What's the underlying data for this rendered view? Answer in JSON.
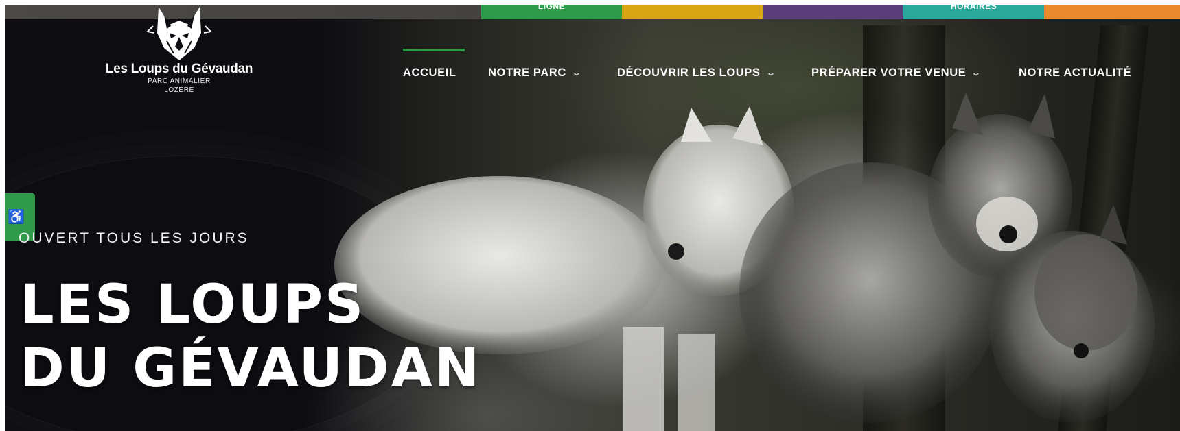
{
  "quick_links": [
    {
      "label": "LIGNE",
      "color": "#2f9a4a"
    },
    {
      "label": "",
      "color": "#d7a514"
    },
    {
      "label": "",
      "color": "#5a3d79"
    },
    {
      "label": "HORAIRES",
      "color": "#2aa99a"
    },
    {
      "label": "",
      "color": "#e98a2f"
    }
  ],
  "logo": {
    "name": "Les Loups du Gévaudan",
    "subtitle_line1": "PARC ANIMALIER",
    "subtitle_line2": "LOZÈRE",
    "icon": "wolf-head-icon"
  },
  "nav": {
    "items": [
      {
        "label": "ACCUEIL",
        "has_dropdown": false,
        "active": true
      },
      {
        "label": "NOTRE PARC",
        "has_dropdown": true,
        "active": false
      },
      {
        "label": "DÉCOUVRIR LES LOUPS",
        "has_dropdown": true,
        "active": false
      },
      {
        "label": "PRÉPARER VOTRE VENUE",
        "has_dropdown": true,
        "active": false
      },
      {
        "label": "NOTRE ACTUALITÉ",
        "has_dropdown": false,
        "active": false
      }
    ],
    "dropdown_icon": "chevron-down-icon",
    "active_color": "#2f9a4a"
  },
  "side_tab": {
    "icon": "accessibility-icon",
    "color": "#2f9a4a"
  },
  "hero": {
    "eyebrow": "OUVERT TOUS LES JOURS",
    "title_line1": "LES LOUPS",
    "title_line2": "DU GÉVAUDAN"
  }
}
